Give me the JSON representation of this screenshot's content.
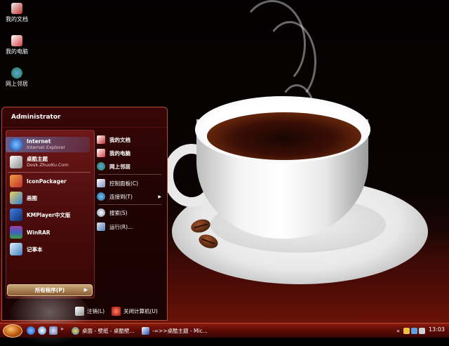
{
  "desktop": {
    "icons": [
      {
        "label": "我的文档",
        "icon": "my-documents-icon"
      },
      {
        "label": "我的电脑",
        "icon": "my-computer-icon"
      },
      {
        "label": "网上邻居",
        "icon": "network-places-icon"
      }
    ]
  },
  "start_menu": {
    "user_name": "Administrator",
    "pinned": [
      {
        "title": "Internet",
        "subtitle": "Internet Explorer",
        "icon": "internet-explorer-icon"
      },
      {
        "title": "桌酷主题",
        "subtitle": "Desk.ZhuoKu.Com",
        "icon": "zhuoku-theme-icon"
      }
    ],
    "recent": [
      {
        "title": "IconPackager",
        "icon": "iconpackager-icon"
      },
      {
        "title": "画图",
        "icon": "paint-icon"
      },
      {
        "title": "KMPlayer中文版",
        "icon": "kmplayer-icon"
      },
      {
        "title": "WinRAR",
        "icon": "winrar-icon"
      },
      {
        "title": "记事本",
        "icon": "notepad-icon"
      }
    ],
    "all_programs": "所有程序(P)",
    "right_items": [
      {
        "label": "我的文档",
        "icon": "my-documents-icon",
        "bold": true
      },
      {
        "label": "我的电脑",
        "icon": "my-computer-icon",
        "bold": true
      },
      {
        "label": "网上邻居",
        "icon": "network-places-icon",
        "bold": true
      },
      {
        "label": "控制面板(C)",
        "icon": "control-panel-icon",
        "bold": false
      },
      {
        "label": "连接到(T)",
        "icon": "connect-to-icon",
        "bold": false,
        "submenu": true
      },
      {
        "label": "搜索(S)",
        "icon": "search-icon",
        "bold": false
      },
      {
        "label": "运行(R)...",
        "icon": "run-icon",
        "bold": false
      }
    ],
    "logoff": "注销(L)",
    "shutdown": "关闭计算机(U)"
  },
  "taskbar": {
    "tasks": [
      {
        "label": "桌面 - 壁纸 - 桌酷壁...",
        "icon": "browser-icon"
      },
      {
        "label": "-=>>桌酷主题 - Mic...",
        "icon": "word-document-icon"
      }
    ],
    "clock": "13:03"
  },
  "colors": {
    "taskbar": "#5a0a05",
    "start_menu_bg": "#200303",
    "accent": "#c04a30"
  }
}
